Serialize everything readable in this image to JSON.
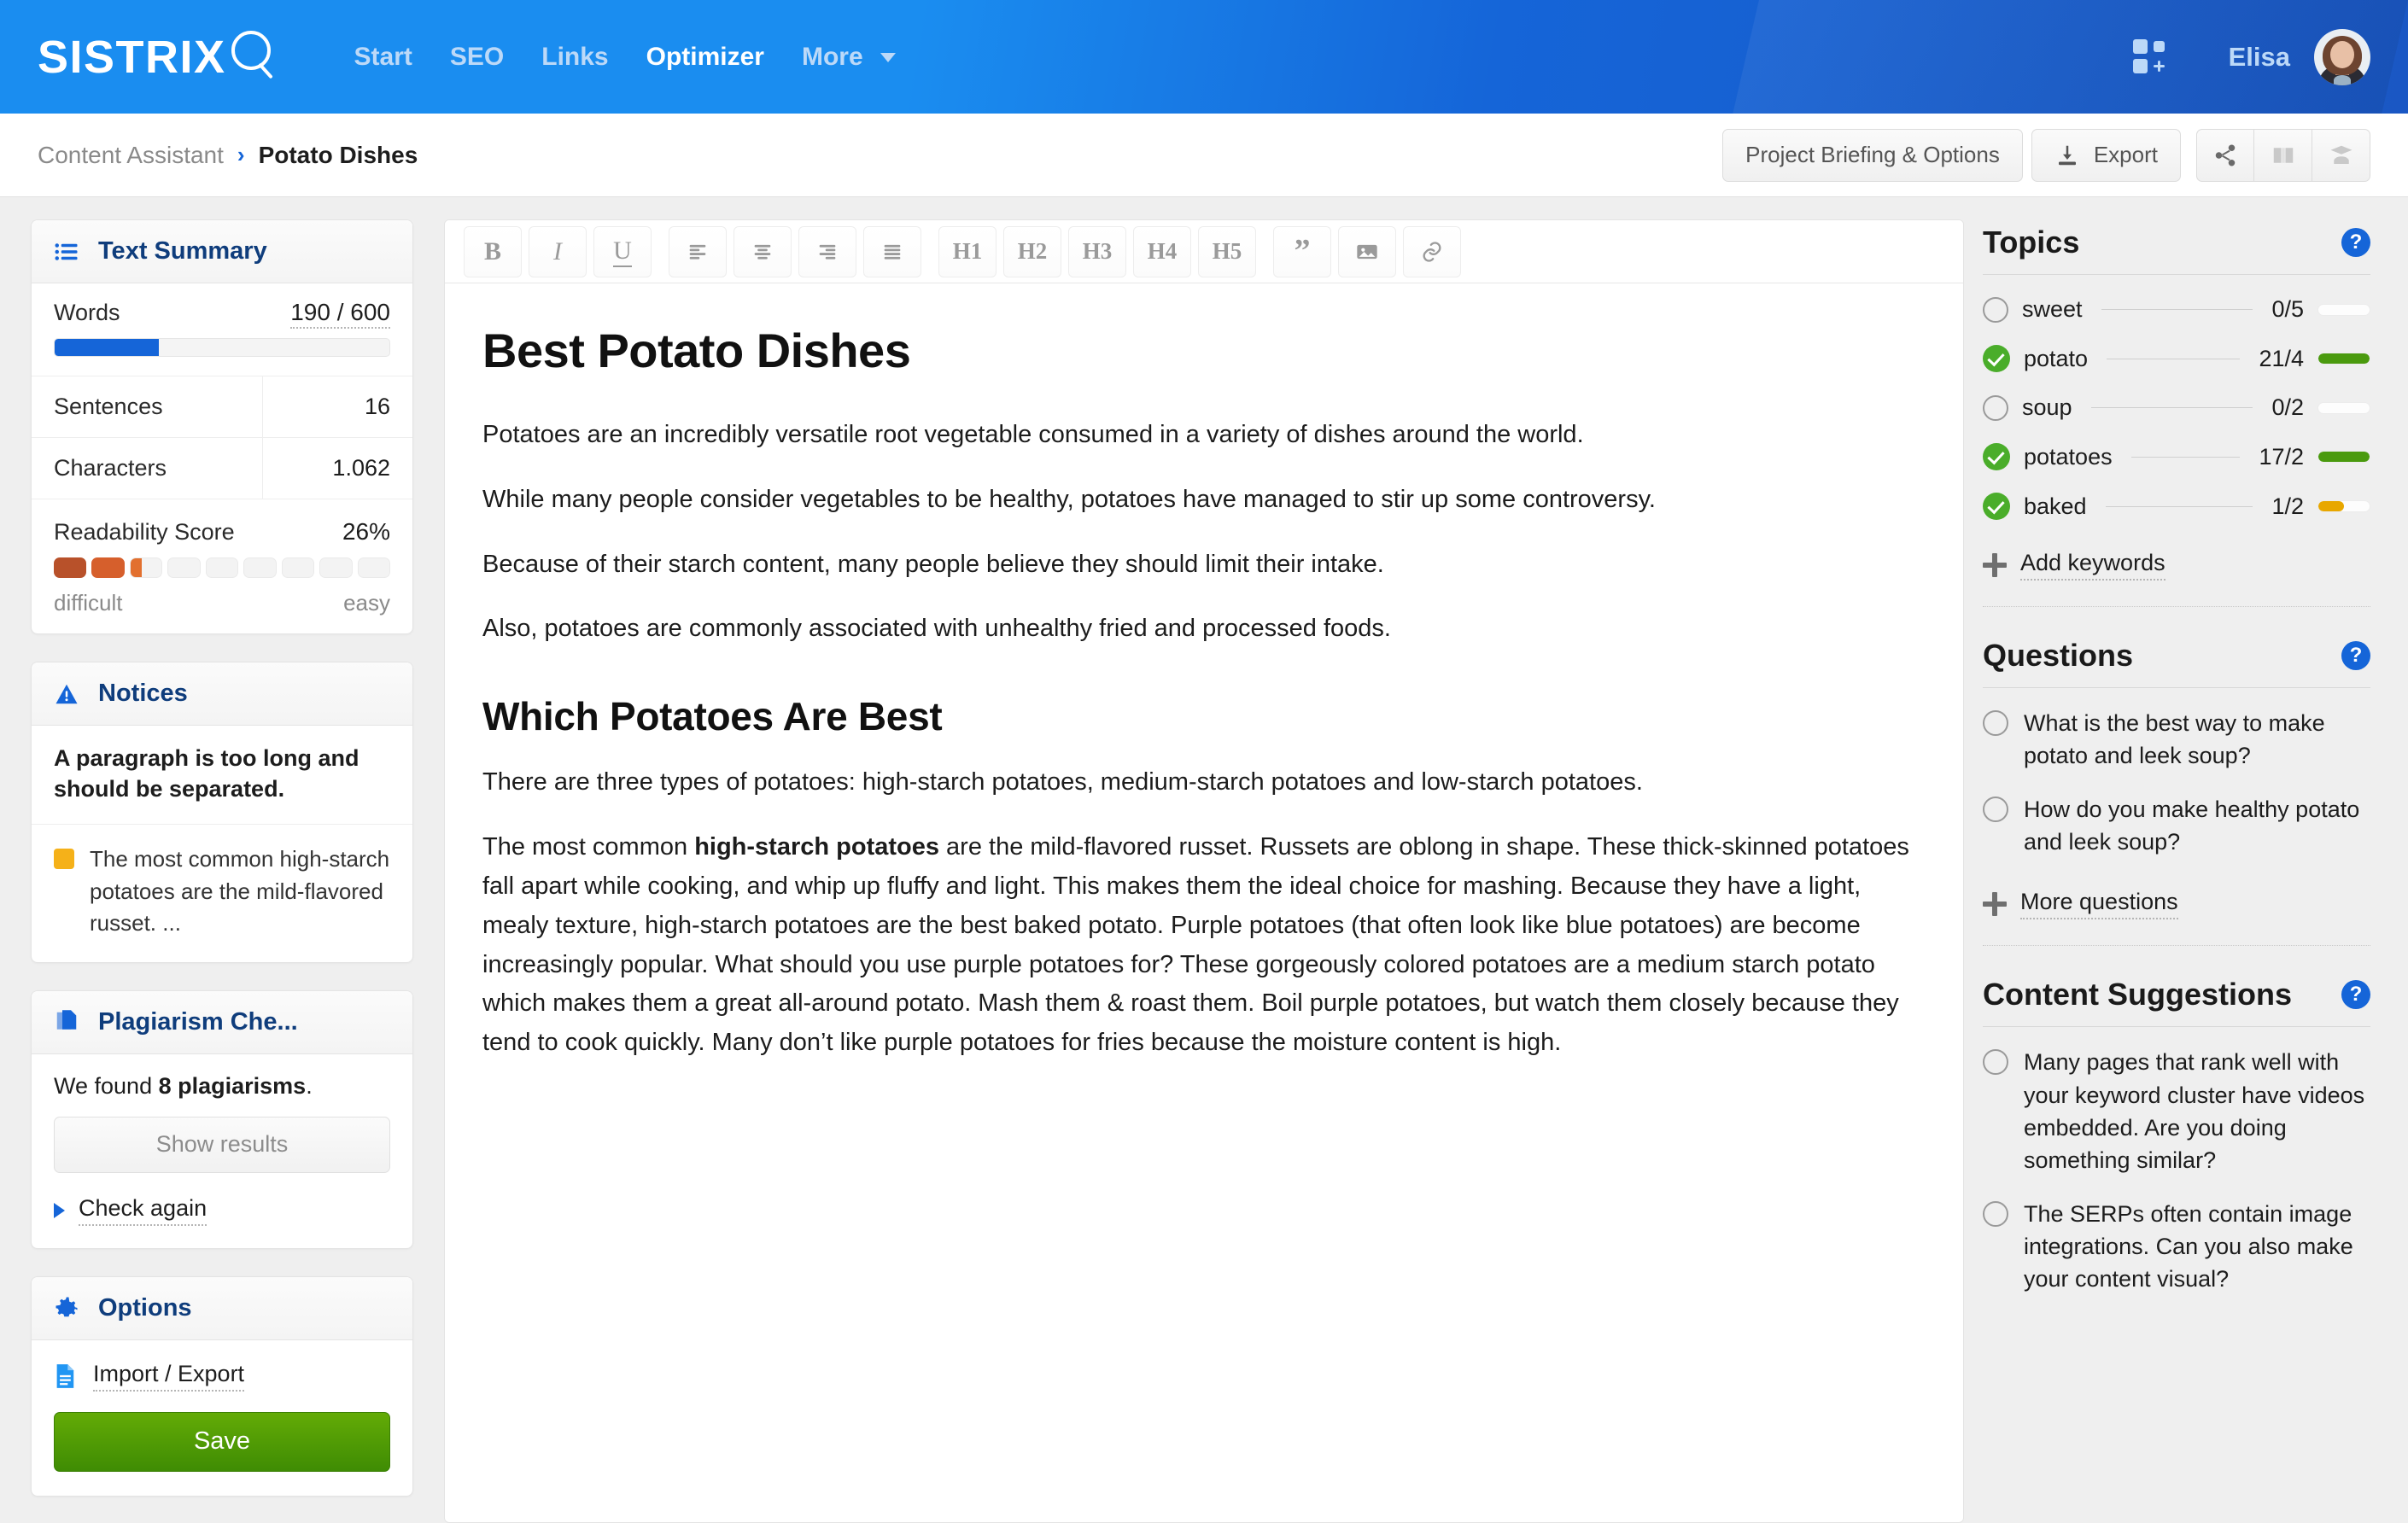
{
  "topnav": {
    "logo_text": "SISTRIX",
    "logo_icon": "magnifier-icon",
    "items": [
      {
        "label": "Start",
        "active": false
      },
      {
        "label": "SEO",
        "active": false
      },
      {
        "label": "Links",
        "active": false
      },
      {
        "label": "Optimizer",
        "active": true
      },
      {
        "label": "More",
        "active": false,
        "caret": true
      }
    ],
    "apps_icon": "apps-grid-add-icon",
    "user_name": "Elisa",
    "avatar": "user-avatar"
  },
  "breadcrumb": {
    "parent": "Content Assistant",
    "separator": "›",
    "current": "Potato Dishes",
    "actions": {
      "project_briefing": "Project Briefing & Options",
      "export": "Export",
      "icons": [
        "share-icon",
        "book-icon",
        "academy-icon"
      ]
    }
  },
  "left": {
    "text_summary": {
      "title": "Text Summary",
      "icon": "list-icon",
      "words_label": "Words",
      "words_value": "190 / 600",
      "words_progress_pct": 31,
      "rows": [
        {
          "label": "Sentences",
          "value": "16"
        },
        {
          "label": "Characters",
          "value": "1.062"
        }
      ],
      "readability_label": "Readability Score",
      "readability_value": "26%",
      "readability_segments": 9,
      "readability_filled": 2,
      "readability_partial": true,
      "scale_left": "difficult",
      "scale_right": "easy"
    },
    "notices": {
      "title": "Notices",
      "icon": "warning-triangle-icon",
      "headline": "A paragraph is too long and should be separated.",
      "items": [
        {
          "chip_color": "#f5b119",
          "text": "The most common high-starch potatoes are the mild-flavored russet. ..."
        }
      ]
    },
    "plagiarism": {
      "title": "Plagiarism Che...",
      "icon": "copy-documents-icon",
      "found_prefix": "We found ",
      "found_count": "8 plagiarisms",
      "found_suffix": ".",
      "show_results_label": "Show results",
      "check_again_label": "Check again"
    },
    "options": {
      "title": "Options",
      "icon": "gear-icon",
      "import_export_label": "Import / Export",
      "save_label": "Save"
    }
  },
  "editor": {
    "toolbar": [
      {
        "label": "B",
        "name": "bold-icon",
        "style": "bold"
      },
      {
        "label": "I",
        "name": "italic-icon",
        "style": "italic"
      },
      {
        "label": "U",
        "name": "underline-icon",
        "style": "underline"
      },
      {
        "label": "",
        "name": "align-left-icon",
        "style": "align-left"
      },
      {
        "label": "",
        "name": "align-center-icon",
        "style": "align-center"
      },
      {
        "label": "",
        "name": "align-right-icon",
        "style": "align-right"
      },
      {
        "label": "",
        "name": "align-justify-icon",
        "style": "align-justify"
      },
      {
        "label": "H1",
        "name": "heading-1-button",
        "style": "h"
      },
      {
        "label": "H2",
        "name": "heading-2-button",
        "style": "h"
      },
      {
        "label": "H3",
        "name": "heading-3-button",
        "style": "h"
      },
      {
        "label": "H4",
        "name": "heading-4-button",
        "style": "h"
      },
      {
        "label": "H5",
        "name": "heading-5-button",
        "style": "h"
      },
      {
        "label": "”",
        "name": "blockquote-icon",
        "style": "quote"
      },
      {
        "label": "",
        "name": "image-icon",
        "style": "image"
      },
      {
        "label": "",
        "name": "link-icon",
        "style": "link"
      }
    ],
    "document": {
      "h1": "Best Potato Dishes",
      "p1": "Potatoes are an incredibly versatile root vegetable consumed in a variety of dishes around the world.",
      "p2": "While many people consider vegetables to be healthy, potatoes have managed to stir up some controversy.",
      "p3": "Because of their starch content, many people believe they should limit their intake.",
      "p4": "Also, potatoes are commonly associated with unhealthy fried and processed foods.",
      "h2": "Which Potatoes Are Best",
      "p5": "There are three types of potatoes: high-starch potatoes, medium-starch potatoes and low-starch potatoes.",
      "p6_before": "The most common ",
      "p6_bold": "high-starch potatoes",
      "p6_after": " are the mild-flavored russet. Russets are oblong in shape. These thick-skinned potatoes fall apart while cooking, and whip up fluffy and light. This makes them the ideal choice for mashing. Because they have a light, mealy texture, high-starch potatoes are the best baked potato. Purple potatoes (that often look like blue potatoes) are become increasingly popular. What should you use purple potatoes for? These gorgeously colored potatoes are a medium starch potato which makes them a great all-around potato. Mash them & roast them. Boil purple potatoes, but watch them closely because they tend to cook quickly. Many don’t like purple potatoes for fries because the moisture content is high."
    }
  },
  "right": {
    "topics": {
      "title": "Topics",
      "help_icon": "help-question-icon",
      "items": [
        {
          "label": "sweet",
          "checked": false,
          "count": "0/5",
          "bar_pct": 0,
          "bar_color": "#ffffff"
        },
        {
          "label": "potato",
          "checked": true,
          "count": "21/4",
          "bar_pct": 100,
          "bar_color": "#4a9a0e"
        },
        {
          "label": "soup",
          "checked": false,
          "count": "0/2",
          "bar_pct": 0,
          "bar_color": "#ffffff"
        },
        {
          "label": "potatoes",
          "checked": true,
          "count": "17/2",
          "bar_pct": 100,
          "bar_color": "#4a9a0e"
        },
        {
          "label": "baked",
          "checked": true,
          "count": "1/2",
          "bar_pct": 50,
          "bar_color": "#e8a700"
        }
      ],
      "add_keywords_label": "Add keywords"
    },
    "questions": {
      "title": "Questions",
      "help_icon": "help-question-icon",
      "items": [
        "What is the best way to make potato and leek soup?",
        "How do you make healthy potato and leek soup?"
      ],
      "more_label": "More questions"
    },
    "content_suggestions": {
      "title": "Content Suggestions",
      "help_icon": "help-question-icon",
      "items": [
        "Many pages that rank well with your keyword cluster have videos embedded. Are you doing something similar?",
        "The SERPs often contain image integrations. Can you also make your content visual?"
      ]
    }
  },
  "colors": {
    "brand_blue": "#1565d8",
    "nav_blue_light": "#1a8df0",
    "accent_green": "#4a9a0e",
    "save_green": "#4e9c05",
    "warn_amber": "#f5b119",
    "topic_amber": "#e8a700",
    "readability_dark": "#b8512a",
    "readability_mid": "#d65f2c"
  }
}
